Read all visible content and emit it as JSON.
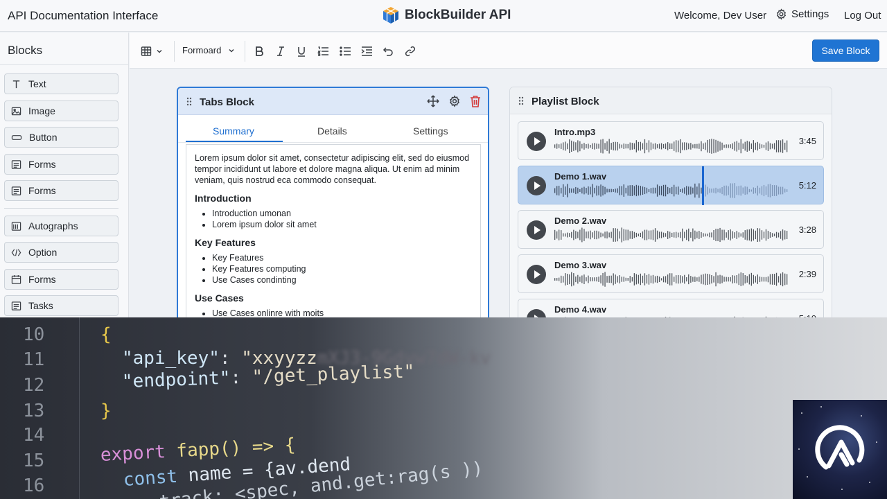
{
  "header": {
    "app_title": "API Documentation Interface",
    "brand_name": "BlockBuilder API",
    "welcome": "Welcome, Dev User",
    "settings": "Settings",
    "logout": "Log Out"
  },
  "sidebar": {
    "title": "Blocks",
    "items": [
      {
        "label": "Text",
        "icon": "text-icon"
      },
      {
        "label": "Image",
        "icon": "image-icon"
      },
      {
        "label": "Button",
        "icon": "button-icon"
      },
      {
        "label": "Forms",
        "icon": "form-icon"
      },
      {
        "label": "Forms",
        "icon": "form-icon"
      },
      {
        "label": "Autographs",
        "icon": "signature-icon"
      },
      {
        "label": "Option",
        "icon": "code-icon"
      },
      {
        "label": "Forms",
        "icon": "calendar-icon"
      },
      {
        "label": "Tasks",
        "icon": "tasks-icon"
      }
    ]
  },
  "toolbar": {
    "format": "Formoard",
    "save_label": "Save Block"
  },
  "tabs_block": {
    "title": "Tabs Block",
    "tabs": [
      "Summary",
      "Details",
      "Settings"
    ],
    "active_tab": "Summary",
    "intro": "Lorem ipsum dolor sit amet, consectetur adipiscing elit, sed do eiusmod tempor incididunt ut labore et dolore magna aliqua. Ut enim ad minim veniam, quis nostrud eca commodo consequat.",
    "sections": [
      {
        "heading": "Introduction",
        "bullets": [
          "Introduction umonan",
          "Lorem ipsum dolor sit amet"
        ]
      },
      {
        "heading": "Key Features",
        "bullets": [
          "Key Features",
          "Key Features computing",
          "Use Cases condinting"
        ]
      },
      {
        "heading": "Use Cases",
        "bullets": [
          "Use Cases onlinre with moits"
        ]
      }
    ]
  },
  "playlist_block": {
    "title": "Playlist Block",
    "tracks": [
      {
        "name": "Intro.mp3",
        "duration": "3:45",
        "progress": 0
      },
      {
        "name": "Demo 1.wav",
        "duration": "5:12",
        "progress": 0.63
      },
      {
        "name": "Demo 2.wav",
        "duration": "3:28",
        "progress": 0
      },
      {
        "name": "Demo 3.wav",
        "duration": "2:39",
        "progress": 0
      },
      {
        "name": "Demo 4.wav",
        "duration": "5:10",
        "progress": 0
      }
    ]
  },
  "code": {
    "line_numbers": [
      "10",
      "11",
      "12",
      "13",
      "14",
      "15",
      "16"
    ],
    "open_brace": "{",
    "api_key_label": "\"api_key\"",
    "api_key_value": "\"xxyyzz",
    "endpoint_label": "\"endpoint\"",
    "endpoint_value": "\"/get_playlist\"",
    "close_brace": "}",
    "export_kw": "export",
    "fn_name": "fapp()",
    "arrow": "=> {",
    "const_kw": "const",
    "name_var": "name",
    "assign": "= {av.dend",
    "track_line": "track: <spec, and.get:rag(s ))"
  }
}
